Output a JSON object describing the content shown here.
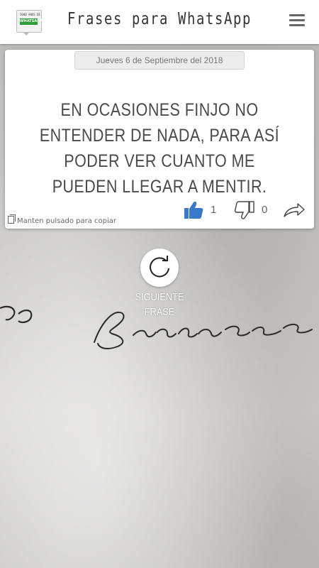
{
  "header": {
    "title": "Frases para WhatsApp",
    "logo": {
      "top_text": "1000 ANOS DE",
      "main_text": "WHATSAPP"
    },
    "menu_icon": "hamburger-menu-icon"
  },
  "card": {
    "date": "Jueves 6 de Septiembre del 2018",
    "quote": "EN OCASIONES FINJO NO ENTENDER DE NADA, PARA ASÍ PODER VER CUANTO ME PUEDEN LLEGAR A MENTIR.",
    "likes": "1",
    "dislikes": "0",
    "copy_hint": "Manten pulsado para copiar",
    "icons": {
      "like": "thumbs-up-icon",
      "dislike": "thumbs-down-icon",
      "share": "share-arrow-icon",
      "copy": "copy-icon"
    }
  },
  "next": {
    "line1": "SIGUIENTE",
    "line2": "FRASE",
    "icon": "refresh-icon"
  },
  "colors": {
    "like_blue": "#3a78c9",
    "header_bg": "#ffffff",
    "text_gray": "#4a4a4a"
  }
}
